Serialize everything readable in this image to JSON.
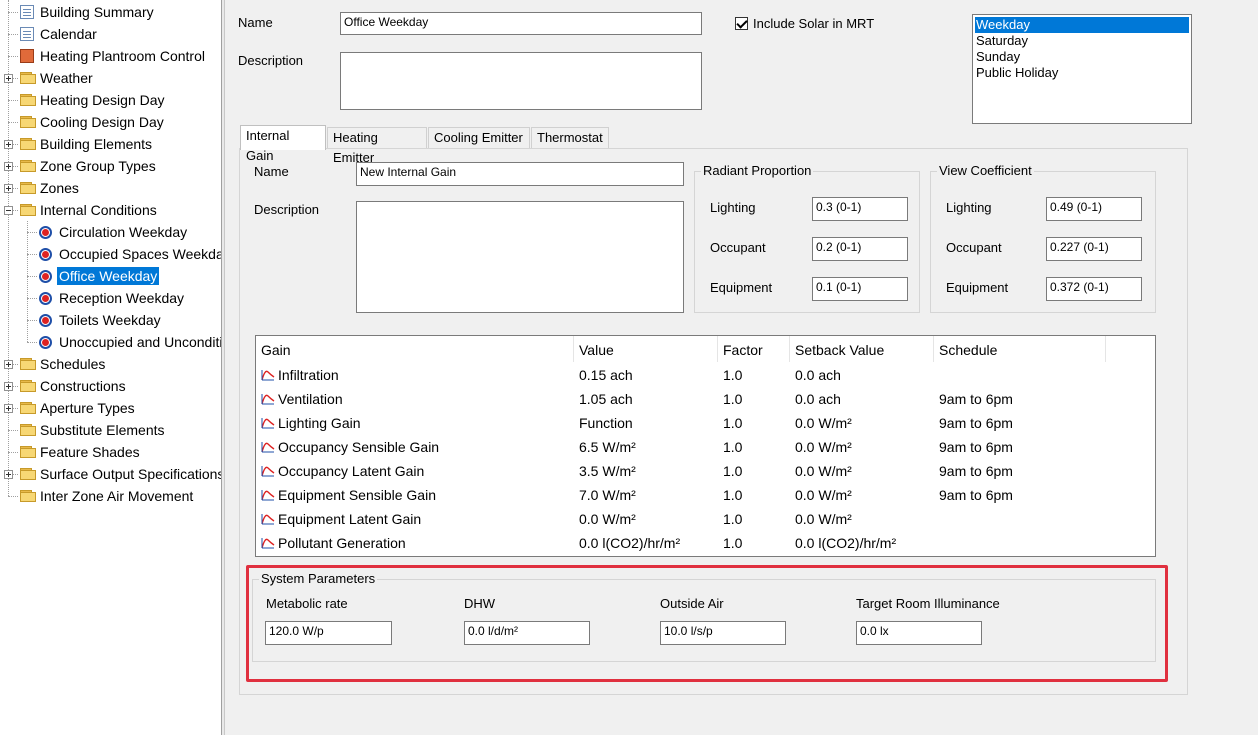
{
  "tree": {
    "items": [
      {
        "label": "Building Summary",
        "icon": "document-icon"
      },
      {
        "label": "Calendar",
        "icon": "document-icon"
      },
      {
        "label": "Heating Plantroom Control",
        "icon": "plant-icon"
      },
      {
        "label": "Weather",
        "icon": "folder-icon"
      },
      {
        "label": "Heating Design Day",
        "icon": "folder-icon"
      },
      {
        "label": "Cooling Design Day",
        "icon": "folder-icon"
      },
      {
        "label": "Building Elements",
        "icon": "folder-icon"
      },
      {
        "label": "Zone Group Types",
        "icon": "folder-icon"
      },
      {
        "label": "Zones",
        "icon": "folder-icon"
      },
      {
        "label": "Internal Conditions",
        "icon": "folder-icon"
      },
      {
        "label": "Circulation Weekday",
        "icon": "internal-condition-icon"
      },
      {
        "label": "Occupied Spaces Weekday",
        "icon": "internal-condition-icon"
      },
      {
        "label": "Office Weekday",
        "icon": "internal-condition-icon"
      },
      {
        "label": "Reception Weekday",
        "icon": "internal-condition-icon"
      },
      {
        "label": "Toilets Weekday",
        "icon": "internal-condition-icon"
      },
      {
        "label": "Unoccupied and Unconditioned",
        "icon": "internal-condition-icon"
      },
      {
        "label": "Schedules",
        "icon": "folder-icon"
      },
      {
        "label": "Constructions",
        "icon": "folder-icon"
      },
      {
        "label": "Aperture Types",
        "icon": "folder-icon"
      },
      {
        "label": "Substitute Elements",
        "icon": "folder-icon"
      },
      {
        "label": "Feature Shades",
        "icon": "folder-icon"
      },
      {
        "label": "Surface Output Specifications",
        "icon": "folder-icon"
      },
      {
        "label": "Inter Zone Air Movement",
        "icon": "folder-icon"
      }
    ],
    "selected": "Office Weekday"
  },
  "header": {
    "name_label": "Name",
    "name_value": "Office Weekday",
    "description_label": "Description",
    "description_value": "",
    "solar_checkbox_label": "Include Solar in MRT",
    "solar_checked": true,
    "day_types": [
      "Weekday",
      "Saturday",
      "Sunday",
      "Public Holiday"
    ],
    "selected_day": "Weekday"
  },
  "tabs": [
    "Internal Gain",
    "Heating Emitter",
    "Cooling Emitter",
    "Thermostat"
  ],
  "active_tab": "Internal Gain",
  "gain": {
    "name_label": "Name",
    "name_value": "New Internal Gain",
    "description_label": "Description",
    "description_value": ""
  },
  "radiant": {
    "title": "Radiant Proportion",
    "lighting_label": "Lighting",
    "lighting_value": "0.3 (0-1)",
    "occupant_label": "Occupant",
    "occupant_value": "0.2 (0-1)",
    "equipment_label": "Equipment",
    "equipment_value": "0.1 (0-1)"
  },
  "view": {
    "title": "View Coefficient",
    "lighting_label": "Lighting",
    "lighting_value": "0.49 (0-1)",
    "occupant_label": "Occupant",
    "occupant_value": "0.227 (0-1)",
    "equipment_label": "Equipment",
    "equipment_value": "0.372 (0-1)"
  },
  "table": {
    "headers": [
      "Gain",
      "Value",
      "Factor",
      "Setback Value",
      "Schedule"
    ],
    "rows": [
      {
        "gain": "Infiltration",
        "value": "0.15 ach",
        "factor": "1.0",
        "setback": "0.0 ach",
        "schedule": ""
      },
      {
        "gain": "Ventilation",
        "value": "1.05 ach",
        "factor": "1.0",
        "setback": "0.0 ach",
        "schedule": "9am to 6pm"
      },
      {
        "gain": "Lighting Gain",
        "value": "Function",
        "factor": "1.0",
        "setback": "0.0 W/m²",
        "schedule": "9am to 6pm"
      },
      {
        "gain": "Occupancy Sensible Gain",
        "value": "6.5 W/m²",
        "factor": "1.0",
        "setback": "0.0 W/m²",
        "schedule": "9am to 6pm"
      },
      {
        "gain": "Occupancy Latent Gain",
        "value": "3.5 W/m²",
        "factor": "1.0",
        "setback": "0.0 W/m²",
        "schedule": "9am to 6pm"
      },
      {
        "gain": "Equipment Sensible Gain",
        "value": "7.0 W/m²",
        "factor": "1.0",
        "setback": "0.0 W/m²",
        "schedule": "9am to 6pm"
      },
      {
        "gain": "Equipment Latent Gain",
        "value": "0.0 W/m²",
        "factor": "1.0",
        "setback": "0.0 W/m²",
        "schedule": ""
      },
      {
        "gain": "Pollutant Generation",
        "value": "0.0 l(CO2)/hr/m²",
        "factor": "1.0",
        "setback": "0.0 l(CO2)/hr/m²",
        "schedule": ""
      }
    ]
  },
  "system": {
    "title": "System Parameters",
    "metabolic_label": "Metabolic rate",
    "metabolic_value": "120.0 W/p",
    "dhw_label": "DHW",
    "dhw_value": "0.0 l/d/m²",
    "outside_air_label": "Outside Air",
    "outside_air_value": "10.0 l/s/p",
    "illuminance_label": "Target Room Illuminance",
    "illuminance_value": "0.0 lx"
  },
  "colors": {
    "selection": "#0078d7",
    "highlight_box": "#e0303f"
  }
}
